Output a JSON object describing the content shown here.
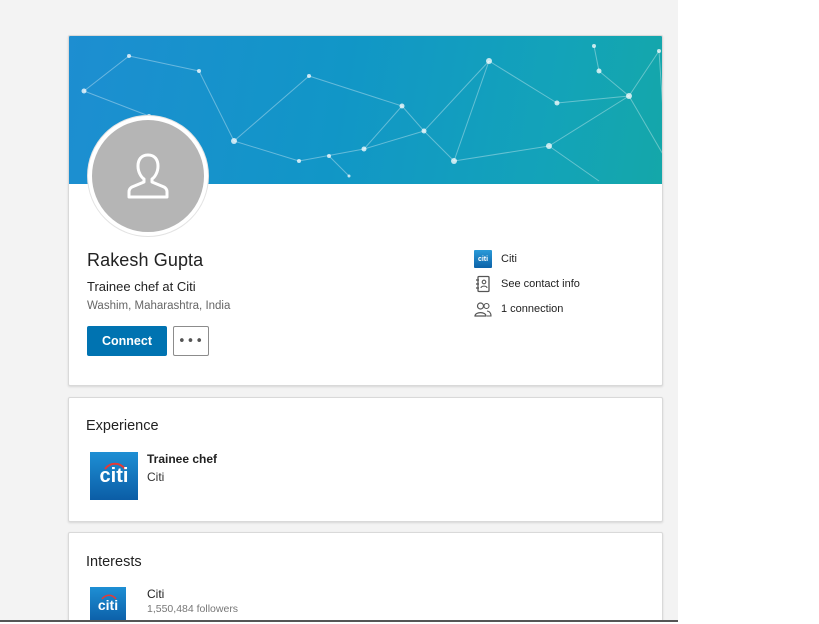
{
  "profile": {
    "name": "Rakesh Gupta",
    "headline": "Trainee chef at Citi",
    "location": "Washim, Maharashtra, India",
    "connect_label": "Connect",
    "more_label": "•••"
  },
  "side_info": {
    "company": "Citi",
    "contact_info": "See contact info",
    "connections": "1 connection"
  },
  "experience": {
    "title": "Experience",
    "items": [
      {
        "role": "Trainee chef",
        "company": "Citi",
        "logo_text": "citi"
      }
    ]
  },
  "interests": {
    "title": "Interests",
    "items": [
      {
        "name": "Citi",
        "followers": "1,550,484 followers",
        "logo_text": "citi"
      }
    ]
  },
  "colors": {
    "accent": "#0073b1",
    "banner_start": "#1d8ed1",
    "banner_end": "#14a7a9",
    "page_background": "#f3f3f3"
  },
  "icons": {
    "company": "citi-logo-icon",
    "contact": "address-book-icon",
    "connections": "people-icon",
    "avatar": "person-silhouette-icon",
    "more": "ellipsis-icon"
  }
}
